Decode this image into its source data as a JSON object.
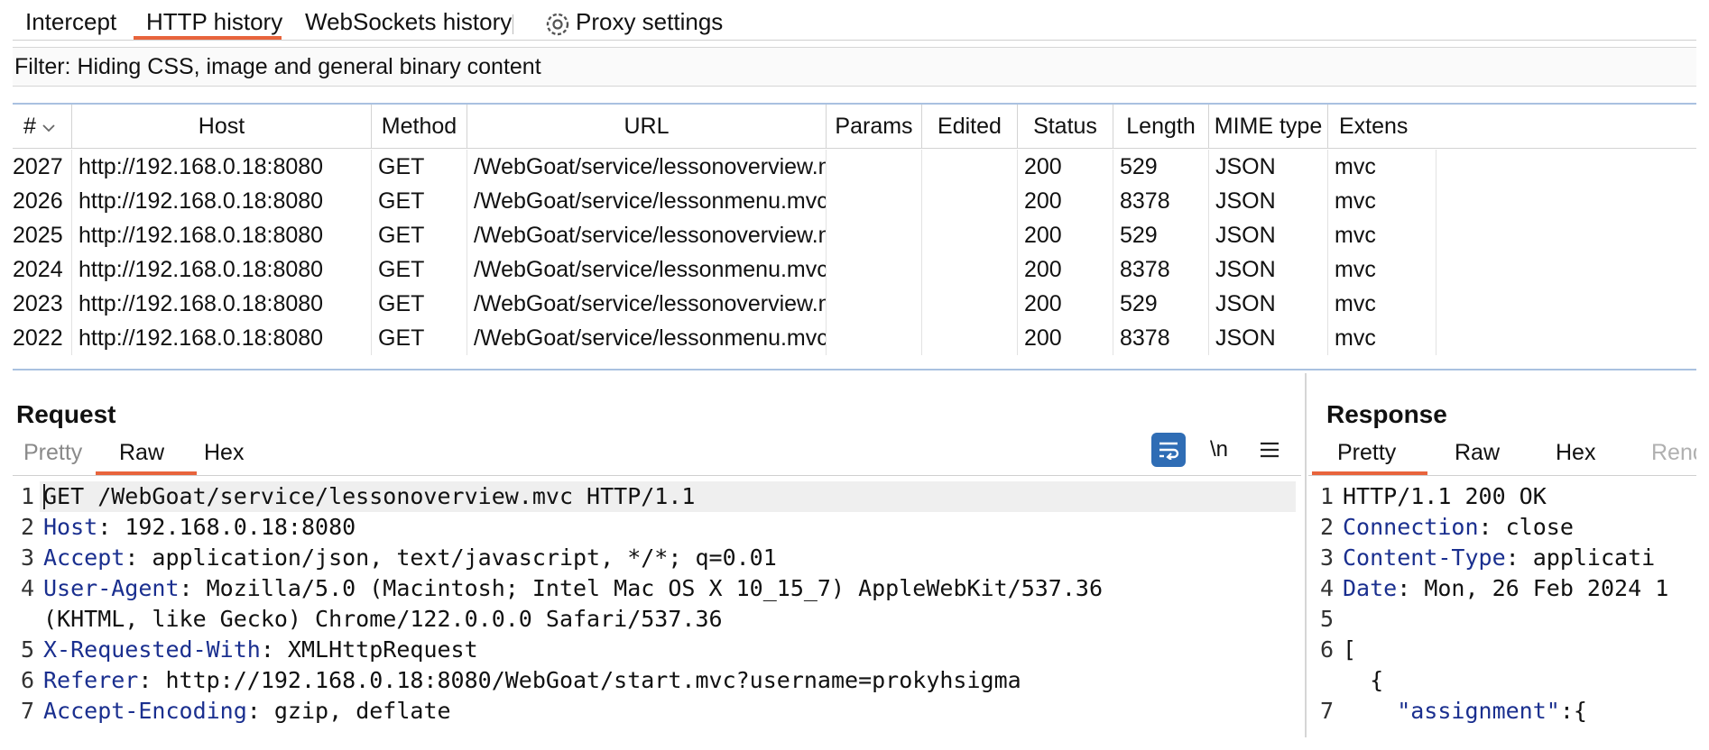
{
  "tabs": [
    {
      "label": "Intercept"
    },
    {
      "label": "HTTP history"
    },
    {
      "label": "WebSockets history"
    },
    {
      "label": "Proxy settings"
    }
  ],
  "filter": {
    "text": "Filter: Hiding CSS, image and general binary content"
  },
  "table": {
    "columns": [
      "#",
      "Host",
      "Method",
      "URL",
      "Params",
      "Edited",
      "Status",
      "Length",
      "MIME type",
      "Extens"
    ],
    "rows": [
      {
        "num": "2027",
        "host": "http://192.168.0.18:8080",
        "method": "GET",
        "url": "/WebGoat/service/lessonoverview.mvc",
        "status": "200",
        "length": "529",
        "mime": "JSON",
        "ext": "mvc"
      },
      {
        "num": "2026",
        "host": "http://192.168.0.18:8080",
        "method": "GET",
        "url": "/WebGoat/service/lessonmenu.mvc",
        "status": "200",
        "length": "8378",
        "mime": "JSON",
        "ext": "mvc"
      },
      {
        "num": "2025",
        "host": "http://192.168.0.18:8080",
        "method": "GET",
        "url": "/WebGoat/service/lessonoverview.mvc",
        "status": "200",
        "length": "529",
        "mime": "JSON",
        "ext": "mvc"
      },
      {
        "num": "2024",
        "host": "http://192.168.0.18:8080",
        "method": "GET",
        "url": "/WebGoat/service/lessonmenu.mvc",
        "status": "200",
        "length": "8378",
        "mime": "JSON",
        "ext": "mvc"
      },
      {
        "num": "2023",
        "host": "http://192.168.0.18:8080",
        "method": "GET",
        "url": "/WebGoat/service/lessonoverview.mvc",
        "status": "200",
        "length": "529",
        "mime": "JSON",
        "ext": "mvc"
      },
      {
        "num": "2022",
        "host": "http://192.168.0.18:8080",
        "method": "GET",
        "url": "/WebGoat/service/lessonmenu.mvc",
        "status": "200",
        "length": "8378",
        "mime": "JSON",
        "ext": "mvc"
      }
    ]
  },
  "request": {
    "title": "Request",
    "tabs": [
      "Pretty",
      "Raw",
      "Hex"
    ],
    "active_tab": "Raw",
    "newline_toggle": "\\n",
    "lines": [
      {
        "n": "1",
        "key": "",
        "rest": "GET /WebGoat/service/lessonoverview.mvc HTTP/1.1"
      },
      {
        "n": "2",
        "key": "Host",
        "rest": ": 192.168.0.18:8080"
      },
      {
        "n": "3",
        "key": "Accept",
        "rest": ": application/json, text/javascript, */*; q=0.01"
      },
      {
        "n": "4",
        "key": "User-Agent",
        "rest": ": Mozilla/5.0 (Macintosh; Intel Mac OS X 10_15_7) AppleWebKit/537.36"
      },
      {
        "n": "",
        "key": "",
        "rest": "(KHTML, like Gecko) Chrome/122.0.0.0 Safari/537.36"
      },
      {
        "n": "5",
        "key": "X-Requested-With",
        "rest": ": XMLHttpRequest"
      },
      {
        "n": "6",
        "key": "Referer",
        "rest": ": http://192.168.0.18:8080/WebGoat/start.mvc?username=prokyhsigma"
      },
      {
        "n": "7",
        "key": "Accept-Encoding",
        "rest": ": gzip, deflate"
      }
    ]
  },
  "response": {
    "title": "Response",
    "tabs": [
      "Pretty",
      "Raw",
      "Hex",
      "Rend"
    ],
    "active_tab": "Pretty",
    "lines": [
      {
        "n": "1",
        "key": "",
        "rest": "HTTP/1.1 200 OK"
      },
      {
        "n": "2",
        "key": "Connection",
        "rest": ": close"
      },
      {
        "n": "3",
        "key": "Content-Type",
        "rest": ": applicati"
      },
      {
        "n": "4",
        "key": "Date",
        "rest": ": Mon, 26 Feb 2024 1"
      },
      {
        "n": "5",
        "key": "",
        "rest": ""
      },
      {
        "n": "6",
        "key": "",
        "rest": "["
      },
      {
        "n": "",
        "key": "",
        "rest": "  {"
      },
      {
        "n": "7",
        "key": "    \"assignment\"",
        "rest": ":{"
      }
    ]
  },
  "colors": {
    "accent": "#e8643c",
    "header_key": "#1a2f8f",
    "wrap_button": "#2f6db5"
  }
}
